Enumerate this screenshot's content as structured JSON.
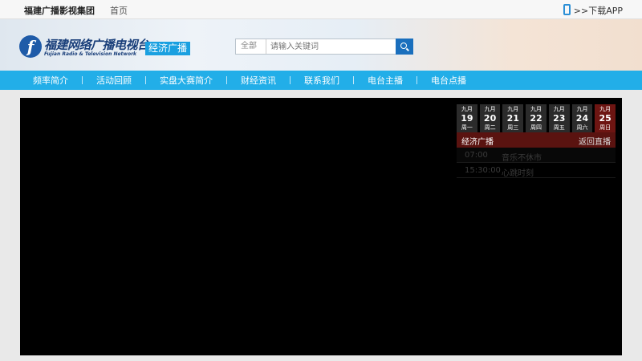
{
  "topbar": {
    "brand": "福建广播影视集团",
    "home": "首页",
    "app": ">>下载APP"
  },
  "header": {
    "logo_letter": "f",
    "logo_cn": "福建网络广播电视台",
    "logo_dot": ".",
    "logo_en": "Fujian Radio & Television Network",
    "channel": "经济广播"
  },
  "search": {
    "category": "全部",
    "placeholder": "请输入关键词",
    "value": ""
  },
  "nav": {
    "items": [
      "频率简介",
      "活动回顾",
      "实盘大赛简介",
      "财经资讯",
      "联系我们",
      "电台主播",
      "电台点播"
    ]
  },
  "epg": {
    "days": [
      {
        "month": "九月",
        "date": "19",
        "week": "周一"
      },
      {
        "month": "九月",
        "date": "20",
        "week": "周二"
      },
      {
        "month": "九月",
        "date": "21",
        "week": "周三"
      },
      {
        "month": "九月",
        "date": "22",
        "week": "周四"
      },
      {
        "month": "九月",
        "date": "23",
        "week": "周五"
      },
      {
        "month": "九月",
        "date": "24",
        "week": "周六"
      },
      {
        "month": "九月",
        "date": "25",
        "week": "周日"
      }
    ],
    "active_day": "25",
    "channel": "经济广播",
    "back_live": "返回直播",
    "programs": [
      {
        "time": "07:00",
        "name": "音乐不休市"
      },
      {
        "time": "15:30:00",
        "name": "心跳时刻"
      }
    ]
  },
  "colors": {
    "nav_bg": "#22aee8",
    "accent_blue": "#1aa0e0",
    "active_day": "#6d1512"
  }
}
